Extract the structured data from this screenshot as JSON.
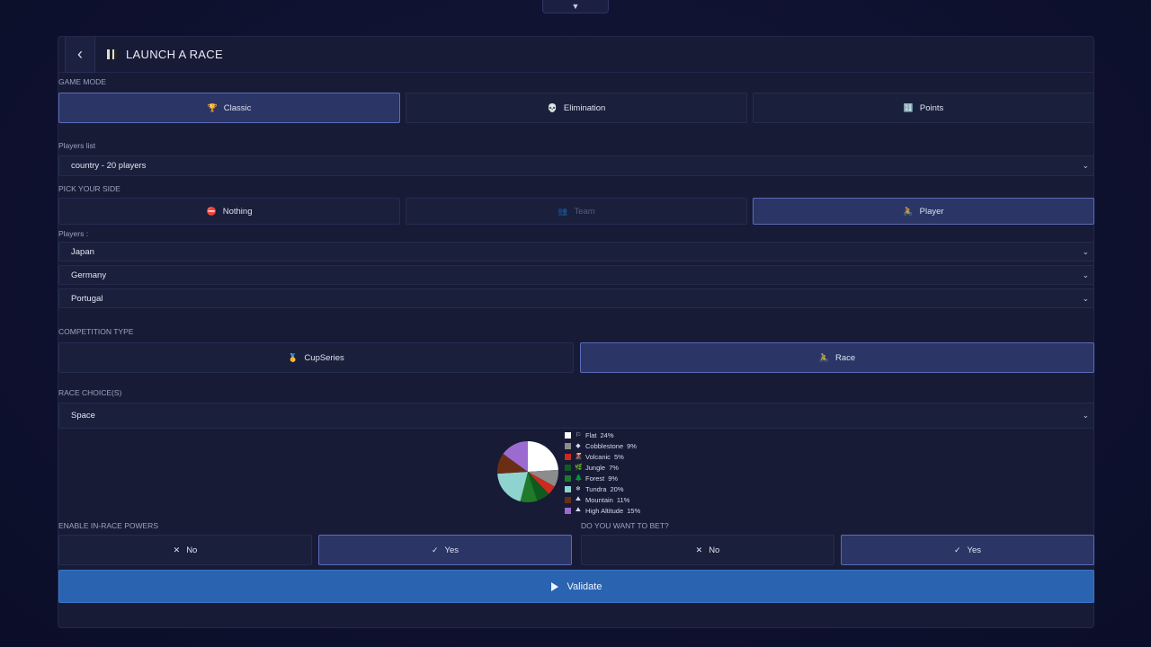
{
  "top_toggle": {
    "icon": "triangle-down-icon",
    "glyph": "▼"
  },
  "header": {
    "back_glyph": "‹",
    "title": "LAUNCH A RACE"
  },
  "game_mode": {
    "label": "GAME MODE",
    "options": [
      {
        "label": "Classic",
        "icon": "🏆",
        "active": true
      },
      {
        "label": "Elimination",
        "icon": "💀",
        "active": false
      },
      {
        "label": "Points",
        "icon": "🔢",
        "active": false
      }
    ]
  },
  "players_list": {
    "label": "Players list",
    "value": "country - 20  players"
  },
  "pick_side": {
    "label": "PICK YOUR SIDE",
    "options": [
      {
        "label": "Nothing",
        "icon": "⛔",
        "active": false,
        "disabled": false
      },
      {
        "label": "Team",
        "icon": "👥",
        "active": false,
        "disabled": true
      },
      {
        "label": "Player",
        "icon": "🚴",
        "active": true,
        "disabled": false
      }
    ]
  },
  "players": {
    "label": "Players :",
    "values": [
      "Japan",
      "Germany",
      "Portugal"
    ]
  },
  "competition_type": {
    "label": "COMPETITION TYPE",
    "options": [
      {
        "label": "CupSeries",
        "icon": "🥇",
        "active": false
      },
      {
        "label": "Race",
        "icon": "🚴",
        "active": true
      }
    ]
  },
  "race_choice": {
    "label": "RACE CHOICE(S)",
    "value": "Space"
  },
  "chart_data": {
    "type": "pie",
    "series": [
      {
        "name": "Flat",
        "value": 24,
        "color": "#ffffff",
        "icon": "⚐"
      },
      {
        "name": "Cobblestone",
        "value": 9,
        "color": "#8c8c8c",
        "icon": "◆"
      },
      {
        "name": "Volcanic",
        "value": 5,
        "color": "#cc2a1e",
        "icon": "🌋"
      },
      {
        "name": "Jungle",
        "value": 7,
        "color": "#0f5a1e",
        "icon": "🌿"
      },
      {
        "name": "Forest",
        "value": 9,
        "color": "#1f7a2a",
        "icon": "🌲"
      },
      {
        "name": "Tundra",
        "value": 20,
        "color": "#8fd3cf",
        "icon": "❄"
      },
      {
        "name": "Mountain",
        "value": 11,
        "color": "#6a2e14",
        "icon": "⛰"
      },
      {
        "name": "High Altitude",
        "value": 15,
        "color": "#9b6bd0",
        "icon": "⛰"
      }
    ]
  },
  "powers": {
    "label": "ENABLE IN-RACE POWERS",
    "options": [
      {
        "label": "No",
        "icon": "✕",
        "active": false
      },
      {
        "label": "Yes",
        "icon": "✓",
        "active": true
      }
    ]
  },
  "bet": {
    "label": "DO YOU WANT TO BET?",
    "options": [
      {
        "label": "No",
        "icon": "✕",
        "active": false
      },
      {
        "label": "Yes",
        "icon": "✓",
        "active": true
      }
    ]
  },
  "validate": {
    "label": "Validate"
  },
  "chevron_glyph": "⌄"
}
